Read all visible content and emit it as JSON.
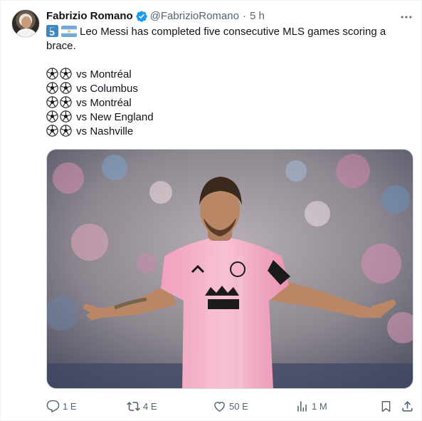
{
  "tweet": {
    "author_name": "Fabrizio Romano",
    "handle": "@FabrizioRomano",
    "separator": "·",
    "time": "5 h",
    "text_line_1": "Leo Messi has completed five consecutive MLS games scoring a",
    "text_line_2": "brace.",
    "games": [
      {
        "label": "vs Montréal"
      },
      {
        "label": "vs Columbus"
      },
      {
        "label": "vs Montréal"
      },
      {
        "label": "vs New England"
      },
      {
        "label": "vs Nashville"
      }
    ]
  },
  "actions": {
    "replies": "1 E",
    "reposts": "4 E",
    "likes": "50 E",
    "views": "1 M"
  },
  "icons": {
    "verified": "verified-badge-icon",
    "more": "more-icon",
    "reply": "reply-icon",
    "repost": "repost-icon",
    "like": "like-icon",
    "views": "views-icon",
    "bookmark": "bookmark-icon",
    "share": "share-icon",
    "emoji_five": "keycap-five-emoji",
    "emoji_flag": "argentina-flag-emoji",
    "emoji_ball": "soccer-ball-emoji"
  },
  "colors": {
    "text": "#0f1419",
    "secondary": "#536471",
    "verified_blue": "#1d9bf0",
    "jersey_pink": "#f3a6c0"
  }
}
